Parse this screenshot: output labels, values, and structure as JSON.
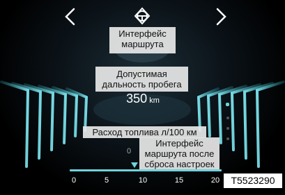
{
  "header": {
    "icons": [
      "chevron-left-icon",
      "steering-wheel-icon",
      "chevron-right-icon"
    ]
  },
  "callouts": {
    "route_interface": [
      "Интерфейс",
      "маршрута"
    ],
    "driving_range": [
      "Допустимая",
      "дальность пробега"
    ],
    "fuel_consumption": "Расход топлива л/100 км",
    "route_after_reset": [
      "Интерфейс",
      "маршрута после",
      "сброса настроек"
    ]
  },
  "range": {
    "value": "350",
    "unit": "km"
  },
  "fuel": {
    "current": "0"
  },
  "scale": {
    "ticks": [
      "0",
      "5",
      "10",
      "15",
      "20"
    ],
    "marker_value": 8.6
  },
  "page_indicator": {
    "count": 4,
    "active_index": 0
  },
  "figure_code": "T5523290",
  "colors": {
    "accent": "#6fd3de",
    "background": "#000000",
    "callout_bg": "#e6e6e6"
  }
}
